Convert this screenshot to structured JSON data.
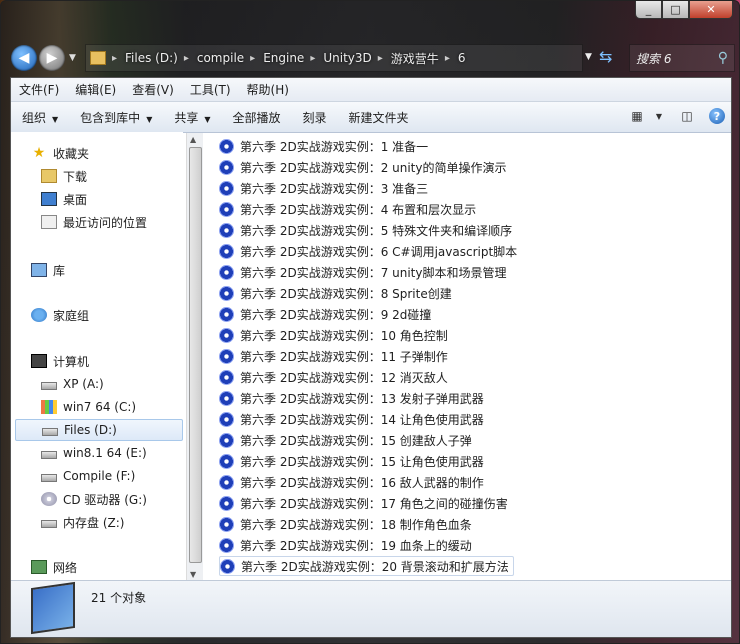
{
  "caption": {
    "minimize": "_",
    "maximize": "□",
    "close": "✕"
  },
  "address": {
    "crumbs": [
      "Files (D:)",
      "compile",
      "Engine",
      "Unity3D",
      "游戏营牛",
      "6"
    ]
  },
  "search": {
    "placeholder": "搜索 6"
  },
  "menu": [
    "文件(F)",
    "编辑(E)",
    "查看(V)",
    "工具(T)",
    "帮助(H)"
  ],
  "toolbar": {
    "organize": "组织",
    "include": "包含到库中",
    "share": "共享",
    "playall": "全部播放",
    "burn": "刻录",
    "newfolder": "新建文件夹"
  },
  "nav": {
    "favorites": "收藏夹",
    "downloads": "下载",
    "desktop": "桌面",
    "recent": "最近访问的位置",
    "libraries": "库",
    "homegroup": "家庭组",
    "computer": "计算机",
    "drives": [
      "XP (A:)",
      "win7 64 (C:)",
      "Files (D:)",
      "win8.1 64 (E:)",
      "Compile (F:)",
      "CD 驱动器 (G:)",
      "内存盘 (Z:)"
    ],
    "network": "网络"
  },
  "files": [
    "第六季 2D实战游戏实例：1 准备一",
    "第六季 2D实战游戏实例：2 unity的简单操作演示",
    "第六季 2D实战游戏实例：3 准备三",
    "第六季 2D实战游戏实例：4 布置和层次显示",
    "第六季 2D实战游戏实例：5 特殊文件夹和编译顺序",
    "第六季 2D实战游戏实例：6 C#调用javascript脚本",
    "第六季 2D实战游戏实例：7 unity脚本和场景管理",
    "第六季 2D实战游戏实例：8 Sprite创建",
    "第六季 2D实战游戏实例：9 2d碰撞",
    "第六季 2D实战游戏实例：10 角色控制",
    "第六季 2D实战游戏实例：11 子弹制作",
    "第六季 2D实战游戏实例：12 消灭敌人",
    "第六季 2D实战游戏实例：13 发射子弹用武器",
    "第六季 2D实战游戏实例：14 让角色使用武器",
    "第六季 2D实战游戏实例：15 创建敌人子弹",
    "第六季 2D实战游戏实例：15 让角色使用武器",
    "第六季 2D实战游戏实例：16 敌人武器的制作",
    "第六季 2D实战游戏实例：17 角色之间的碰撞伤害",
    "第六季 2D实战游戏实例：18 制作角色血条",
    "第六季 2D实战游戏实例：19 血条上的缓动",
    "第六季 2D实战游戏实例：20 背景滚动和扩展方法"
  ],
  "status": {
    "count": "21 个对象"
  }
}
